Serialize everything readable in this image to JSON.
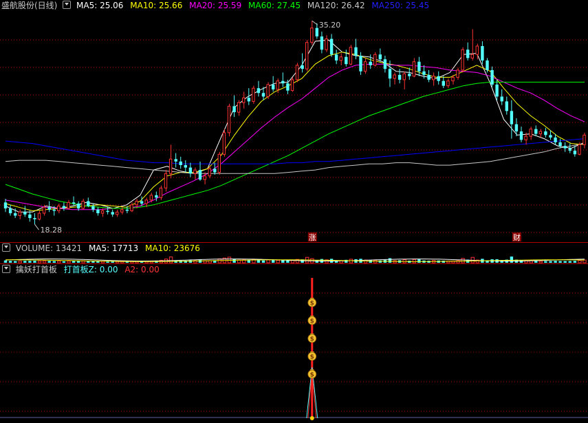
{
  "colors": {
    "background": "#000000",
    "up": "#ff3232",
    "down": "#54ffff",
    "ma5": "#ffffff",
    "ma10": "#ffff00",
    "ma20": "#ff00ff",
    "ma60": "#00ff00",
    "ma120": "#c8c8c8",
    "ma250": "#0000ff",
    "grid": "#b00000"
  },
  "main_legend": {
    "title": "盛航股份(日线)",
    "ma5": "MA5: 25.06",
    "ma10": "MA10: 25.66",
    "ma20": "MA20: 25.59",
    "ma60": "MA60: 27.45",
    "ma120": "MA120: 26.42",
    "ma250": "MA250: 25.45"
  },
  "volume_legend": {
    "title": "VOLUME: 13421",
    "ma5": "MA5: 17713",
    "ma10": "MA10: 23676"
  },
  "indicator_legend": {
    "title": "擒妖打首板",
    "z": "打首板Z: 0.00",
    "a2": "A2: 0.00"
  },
  "annotations": {
    "high": "35.20",
    "low": "18.28",
    "marker_zhang": "涨",
    "marker_cai": "财"
  },
  "chart_data": [
    {
      "type": "candlestick",
      "title": "盛航股份(日线)",
      "ylim": [
        17.6,
        35.9
      ],
      "high_label": 35.2,
      "low_label": 18.28,
      "ohlc": [
        [
          20.1,
          20.4,
          19.3,
          19.6
        ],
        [
          19.6,
          19.9,
          19.0,
          19.2
        ],
        [
          19.2,
          19.6,
          18.8,
          19.0
        ],
        [
          19.0,
          19.5,
          18.7,
          19.3
        ],
        [
          19.3,
          19.8,
          18.9,
          19.1
        ],
        [
          19.1,
          19.4,
          18.5,
          18.8
        ],
        [
          18.8,
          19.2,
          18.28,
          18.7
        ],
        [
          18.7,
          19.4,
          18.6,
          19.2
        ],
        [
          19.2,
          19.9,
          19.0,
          19.7
        ],
        [
          19.7,
          20.2,
          19.3,
          19.5
        ],
        [
          19.5,
          19.8,
          19.0,
          19.4
        ],
        [
          19.4,
          20.0,
          19.2,
          19.8
        ],
        [
          19.8,
          20.1,
          19.4,
          19.6
        ],
        [
          19.6,
          20.3,
          19.5,
          20.1
        ],
        [
          20.1,
          20.6,
          19.8,
          20.0
        ],
        [
          20.0,
          20.2,
          19.4,
          19.6
        ],
        [
          19.6,
          20.4,
          19.5,
          20.2
        ],
        [
          20.2,
          20.5,
          19.7,
          19.8
        ],
        [
          19.8,
          20.0,
          19.3,
          19.5
        ],
        [
          19.5,
          19.7,
          19.0,
          19.2
        ],
        [
          19.2,
          19.6,
          18.9,
          19.4
        ],
        [
          19.4,
          19.7,
          19.1,
          19.3
        ],
        [
          19.3,
          19.5,
          18.9,
          19.1
        ],
        [
          19.1,
          19.5,
          18.9,
          19.3
        ],
        [
          19.3,
          19.7,
          19.1,
          19.5
        ],
        [
          19.5,
          19.8,
          19.2,
          19.4
        ],
        [
          19.4,
          20.1,
          19.3,
          19.9
        ],
        [
          19.9,
          20.4,
          19.6,
          20.2
        ],
        [
          20.2,
          20.6,
          19.8,
          20.0
        ],
        [
          20.0,
          20.5,
          19.7,
          20.3
        ],
        [
          20.3,
          20.9,
          20.1,
          20.7
        ],
        [
          20.7,
          21.0,
          20.2,
          20.5
        ],
        [
          20.5,
          21.5,
          20.3,
          21.3
        ],
        [
          21.3,
          22.8,
          21.0,
          22.5
        ],
        [
          22.5,
          24.9,
          22.1,
          23.7
        ],
        [
          23.7,
          24.2,
          23.0,
          23.5
        ],
        [
          23.5,
          23.9,
          22.9,
          23.2
        ],
        [
          23.2,
          23.6,
          22.6,
          23.0
        ],
        [
          23.0,
          23.4,
          22.2,
          22.5
        ],
        [
          22.5,
          23.0,
          22.0,
          22.8
        ],
        [
          22.8,
          23.5,
          21.9,
          22.0
        ],
        [
          22.0,
          22.6,
          21.6,
          22.3
        ],
        [
          22.3,
          23.1,
          22.1,
          22.9
        ],
        [
          22.9,
          23.4,
          22.4,
          22.6
        ],
        [
          22.6,
          24.3,
          22.4,
          24.1
        ],
        [
          24.1,
          26.2,
          23.9,
          25.9
        ],
        [
          25.9,
          28.3,
          25.6,
          28.1
        ],
        [
          28.1,
          29.0,
          27.2,
          27.6
        ],
        [
          27.6,
          28.6,
          27.3,
          28.4
        ],
        [
          28.4,
          29.3,
          27.9,
          28.8
        ],
        [
          28.8,
          29.6,
          28.2,
          28.5
        ],
        [
          28.5,
          29.8,
          28.3,
          29.6
        ],
        [
          29.6,
          30.2,
          28.9,
          29.2
        ],
        [
          29.2,
          29.7,
          28.6,
          28.9
        ],
        [
          28.9,
          30.1,
          28.7,
          29.9
        ],
        [
          29.9,
          30.6,
          29.3,
          29.5
        ],
        [
          29.5,
          30.4,
          29.2,
          30.2
        ],
        [
          30.2,
          30.9,
          29.7,
          30.0
        ],
        [
          30.0,
          30.3,
          29.1,
          29.4
        ],
        [
          29.4,
          30.5,
          29.3,
          30.3
        ],
        [
          30.3,
          31.7,
          30.1,
          31.5
        ],
        [
          31.5,
          32.5,
          30.9,
          31.2
        ],
        [
          31.2,
          33.6,
          31.0,
          33.4
        ],
        [
          33.4,
          35.2,
          33.2,
          34.6
        ],
        [
          34.6,
          35.0,
          33.7,
          33.9
        ],
        [
          33.9,
          34.3,
          32.5,
          32.8
        ],
        [
          32.8,
          34.0,
          32.6,
          33.7
        ],
        [
          33.7,
          34.1,
          32.2,
          32.4
        ],
        [
          32.4,
          32.8,
          31.6,
          31.9
        ],
        [
          31.9,
          32.5,
          31.5,
          32.2
        ],
        [
          32.2,
          32.8,
          31.4,
          31.6
        ],
        [
          31.6,
          33.2,
          31.5,
          33.0
        ],
        [
          33.0,
          33.7,
          32.0,
          32.3
        ],
        [
          32.3,
          32.6,
          30.7,
          31.0
        ],
        [
          31.0,
          32.1,
          30.8,
          31.8
        ],
        [
          31.8,
          32.4,
          31.2,
          31.5
        ],
        [
          31.5,
          32.6,
          31.4,
          32.4
        ],
        [
          32.4,
          32.9,
          31.8,
          32.0
        ],
        [
          32.0,
          32.3,
          30.9,
          31.2
        ],
        [
          31.2,
          31.9,
          29.7,
          30.4
        ],
        [
          30.4,
          30.9,
          29.9,
          30.7
        ],
        [
          30.7,
          31.2,
          30.0,
          30.3
        ],
        [
          30.3,
          31.0,
          29.5,
          30.8
        ],
        [
          30.8,
          31.3,
          30.3,
          30.6
        ],
        [
          30.6,
          32.1,
          30.5,
          31.8
        ],
        [
          31.8,
          32.2,
          30.6,
          31.0
        ],
        [
          31.0,
          31.5,
          30.4,
          30.7
        ],
        [
          30.7,
          31.1,
          30.1,
          30.3
        ],
        [
          30.3,
          30.9,
          29.8,
          30.6
        ],
        [
          30.6,
          31.0,
          29.9,
          30.2
        ],
        [
          30.2,
          30.6,
          29.6,
          29.8
        ],
        [
          29.8,
          30.4,
          29.6,
          30.2
        ],
        [
          30.2,
          30.7,
          29.9,
          30.5
        ],
        [
          30.5,
          31.3,
          30.3,
          31.1
        ],
        [
          31.1,
          33.0,
          30.9,
          32.8
        ],
        [
          32.8,
          33.4,
          31.9,
          32.1
        ],
        [
          32.1,
          34.5,
          31.9,
          32.4
        ],
        [
          32.4,
          33.3,
          32.0,
          33.1
        ],
        [
          33.1,
          33.5,
          31.6,
          31.9
        ],
        [
          31.9,
          32.1,
          30.9,
          31.1
        ],
        [
          31.1,
          31.4,
          29.7,
          29.9
        ],
        [
          29.9,
          30.3,
          28.6,
          28.9
        ],
        [
          28.9,
          29.5,
          28.2,
          28.5
        ],
        [
          28.5,
          28.9,
          27.4,
          27.7
        ],
        [
          27.7,
          28.6,
          25.4,
          26.6
        ],
        [
          26.6,
          27.1,
          25.6,
          26.0
        ],
        [
          26.0,
          26.4,
          25.1,
          25.3
        ],
        [
          25.3,
          25.9,
          24.9,
          25.6
        ],
        [
          25.6,
          26.4,
          25.3,
          26.2
        ],
        [
          26.2,
          26.5,
          25.6,
          25.8
        ],
        [
          25.8,
          26.2,
          25.5,
          26.0
        ],
        [
          26.0,
          26.3,
          25.5,
          25.7
        ],
        [
          25.7,
          26.1,
          25.3,
          25.5
        ],
        [
          25.5,
          25.8,
          24.9,
          25.1
        ],
        [
          25.1,
          25.4,
          24.6,
          24.8
        ],
        [
          24.8,
          25.1,
          24.3,
          24.6
        ],
        [
          24.6,
          25.0,
          24.2,
          24.4
        ],
        [
          24.4,
          24.8,
          23.9,
          24.1
        ],
        [
          24.1,
          25.1,
          24.0,
          24.9
        ],
        [
          24.9,
          25.9,
          24.6,
          25.7
        ]
      ],
      "ma": {
        "MA5": [
          19.8,
          19.3,
          19.3,
          19.8,
          19.6,
          19.8,
          20.1,
          19.9,
          19.6,
          19.9,
          20.7,
          22.8,
          23.1,
          22.7,
          22.5,
          22.9,
          25.5,
          28.0,
          28.9,
          29.5,
          30.0,
          30.1,
          31.5,
          33.5,
          33.6,
          32.6,
          32.3,
          32.2,
          31.8,
          31.0,
          30.9,
          30.6,
          30.4,
          30.9,
          32.4,
          32.5,
          30.0,
          27.0,
          25.7,
          25.8,
          25.4,
          24.8,
          24.6,
          25.1
        ],
        "MA10": [
          20.0,
          19.7,
          19.4,
          19.5,
          19.6,
          19.7,
          19.8,
          19.9,
          19.8,
          19.7,
          20.2,
          21.4,
          22.3,
          22.6,
          22.6,
          22.9,
          24.0,
          25.7,
          27.2,
          28.5,
          29.3,
          29.8,
          30.4,
          31.6,
          32.3,
          32.6,
          32.4,
          32.0,
          31.7,
          31.5,
          31.2,
          30.8,
          30.5,
          30.5,
          31.0,
          31.5,
          31.0,
          29.6,
          28.3,
          27.3,
          26.5,
          25.6,
          25.0,
          24.9
        ],
        "MA20": [
          20.3,
          20.1,
          19.9,
          19.7,
          19.6,
          19.5,
          19.5,
          19.5,
          19.6,
          19.6,
          19.8,
          20.3,
          20.9,
          21.4,
          21.9,
          22.5,
          23.3,
          24.3,
          25.3,
          26.3,
          27.2,
          28.0,
          28.7,
          29.6,
          30.5,
          31.1,
          31.5,
          31.6,
          31.6,
          31.5,
          31.5,
          31.4,
          31.3,
          31.1,
          31.0,
          30.9,
          30.6,
          30.1,
          29.6,
          29.2,
          28.6,
          27.9,
          27.3,
          26.8
        ],
        "MA60": [
          21.6,
          21.2,
          20.8,
          20.5,
          20.2,
          20.0,
          19.8,
          19.7,
          19.6,
          19.6,
          19.7,
          19.9,
          20.2,
          20.5,
          20.8,
          21.1,
          21.5,
          22.0,
          22.5,
          23.0,
          23.5,
          24.0,
          24.6,
          25.2,
          25.8,
          26.3,
          26.8,
          27.3,
          27.7,
          28.1,
          28.5,
          28.9,
          29.2,
          29.5,
          29.8,
          30.0,
          30.1,
          30.1,
          30.1,
          30.1,
          30.1,
          30.1,
          30.1,
          30.1
        ],
        "MA120": [
          23.5,
          23.6,
          23.6,
          23.6,
          23.5,
          23.4,
          23.3,
          23.2,
          23.1,
          23.0,
          22.9,
          22.8,
          22.7,
          22.6,
          22.5,
          22.5,
          22.5,
          22.5,
          22.5,
          22.5,
          22.5,
          22.6,
          22.7,
          22.8,
          23.0,
          23.1,
          23.2,
          23.3,
          23.3,
          23.4,
          23.4,
          23.3,
          23.2,
          23.2,
          23.3,
          23.4,
          23.5,
          23.7,
          23.9,
          24.1,
          24.3,
          24.6,
          24.8,
          25.0
        ],
        "MA250": [
          25.2,
          25.1,
          25.0,
          24.8,
          24.6,
          24.4,
          24.2,
          24.0,
          23.8,
          23.6,
          23.5,
          23.4,
          23.4,
          23.3,
          23.3,
          23.3,
          23.3,
          23.3,
          23.3,
          23.3,
          23.3,
          23.4,
          23.4,
          23.5,
          23.5,
          23.6,
          23.7,
          23.8,
          23.9,
          24.0,
          24.1,
          24.2,
          24.3,
          24.4,
          24.5,
          24.6,
          24.7,
          24.8,
          24.9,
          25.0,
          25.1,
          25.2,
          25.3,
          25.4
        ]
      }
    },
    {
      "type": "bar",
      "title": "VOLUME",
      "value": 13421,
      "ma5": 17713,
      "ma10": 23676
    },
    {
      "type": "indicator",
      "title": "擒妖打首板",
      "series": [
        {
          "name": "打首板Z",
          "value": 0.0
        },
        {
          "name": "A2",
          "value": 0.0
        }
      ],
      "signal_index": 63,
      "signal_icon": "money-bag-icon",
      "signal_icons": 5
    }
  ]
}
